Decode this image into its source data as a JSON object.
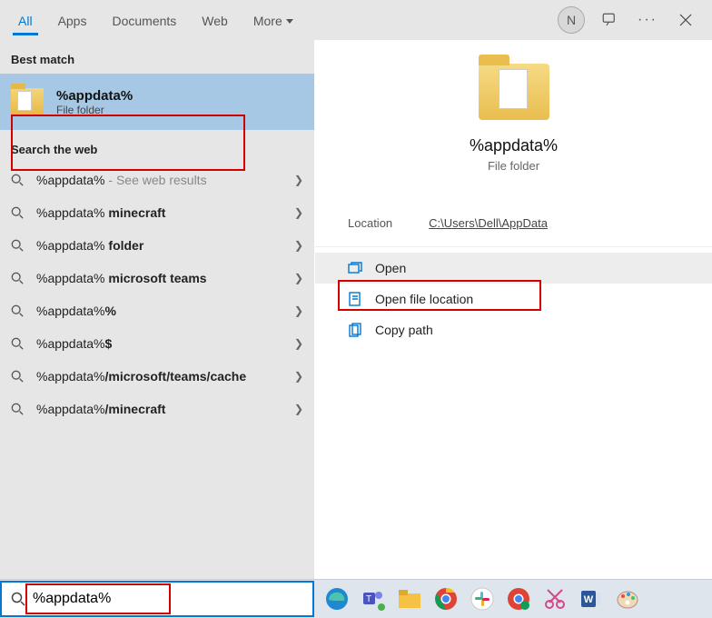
{
  "tabs": {
    "all": "All",
    "apps": "Apps",
    "documents": "Documents",
    "web": "Web",
    "more": "More"
  },
  "avatar_letter": "N",
  "left": {
    "best_match_label": "Best match",
    "best_match": {
      "title": "%appdata%",
      "subtitle": "File folder"
    },
    "search_web_label": "Search the web",
    "items": [
      {
        "term": "%appdata%",
        "suffix": "",
        "hint": " - See web results"
      },
      {
        "term": "%appdata%",
        "suffix": " minecraft",
        "hint": ""
      },
      {
        "term": "%appdata%",
        "suffix": " folder",
        "hint": ""
      },
      {
        "term": "%appdata%",
        "suffix": " microsoft teams",
        "hint": ""
      },
      {
        "term": "%appdata%",
        "suffix": "%",
        "hint": ""
      },
      {
        "term": "%appdata%",
        "suffix": "$",
        "hint": ""
      },
      {
        "term": "%appdata%",
        "suffix": "/microsoft/teams/cache",
        "hint": ""
      },
      {
        "term": "%appdata%",
        "suffix": "/minecraft",
        "hint": ""
      }
    ]
  },
  "right": {
    "title": "%appdata%",
    "subtitle": "File folder",
    "location_label": "Location",
    "location_value": "C:\\Users\\Dell\\AppData",
    "actions": {
      "open": "Open",
      "openloc": "Open file location",
      "copypath": "Copy path"
    }
  },
  "search_value": "%appdata%"
}
